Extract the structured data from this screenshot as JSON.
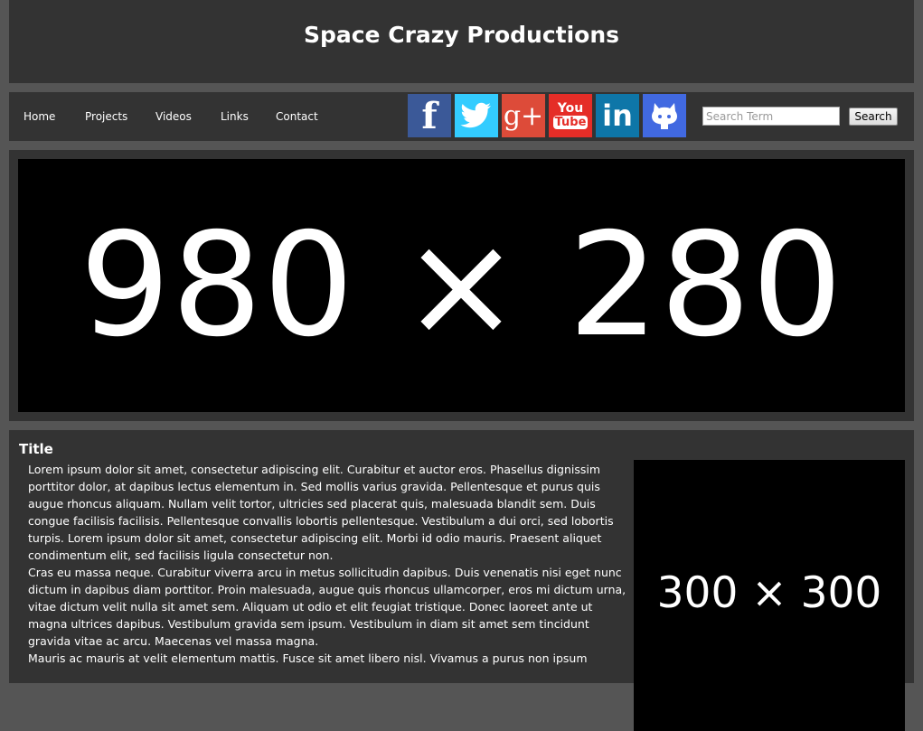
{
  "header": {
    "title": "Space Crazy Productions"
  },
  "nav": {
    "items": [
      {
        "label": "Home"
      },
      {
        "label": "Projects"
      },
      {
        "label": "Videos"
      },
      {
        "label": "Links"
      },
      {
        "label": "Contact"
      }
    ]
  },
  "social": [
    {
      "name": "facebook-icon",
      "glyph": "f",
      "color": "#3b5998"
    },
    {
      "name": "twitter-icon",
      "glyph": "🐦",
      "color": "#33ccff"
    },
    {
      "name": "google-plus-icon",
      "glyph": "g+",
      "color": "#dd4b39"
    },
    {
      "name": "youtube-icon",
      "glyph_top": "You",
      "glyph_bottom": "Tube",
      "color": "#e52d27"
    },
    {
      "name": "linkedin-icon",
      "glyph": "in",
      "color": "#0e76a8"
    },
    {
      "name": "github-icon",
      "glyph": "",
      "color": "#4169e1"
    }
  ],
  "search": {
    "placeholder": "Search Term",
    "button_label": "Search",
    "value": ""
  },
  "banner": {
    "text": "980 × 280"
  },
  "content": {
    "title": "Title",
    "paragraphs": [
      "Lorem ipsum dolor sit amet, consectetur adipiscing elit. Curabitur et auctor eros. Phasellus dignissim porttitor dolor, at dapibus lectus elementum in. Sed mollis varius gravida. Pellentesque et purus quis augue rhoncus aliquam. Nullam velit tortor, ultricies sed placerat quis, malesuada blandit sem. Duis congue facilisis facilisis. Pellentesque convallis lobortis pellentesque. Vestibulum a dui orci, sed lobortis turpis. Lorem ipsum dolor sit amet, consectetur adipiscing elit. Morbi id odio mauris. Praesent aliquet condimentum elit, sed facilisis ligula consectetur non.",
      "Cras eu massa neque. Curabitur viverra arcu in metus sollicitudin dapibus. Duis venenatis nisi eget nunc dictum in dapibus diam porttitor. Proin malesuada, augue quis rhoncus ullamcorper, eros mi dictum urna, vitae dictum velit nulla sit amet sem. Aliquam ut odio et elit feugiat tristique. Donec laoreet ante ut magna ultrices dapibus. Vestibulum gravida sem ipsum. Vestibulum in diam sit amet sem tincidunt gravida vitae ac arcu. Maecenas vel massa magna.",
      "Mauris ac mauris at velit elementum mattis. Fusce sit amet libero nisl. Vivamus a purus non ipsum"
    ],
    "side_image_text": "300 × 300"
  }
}
